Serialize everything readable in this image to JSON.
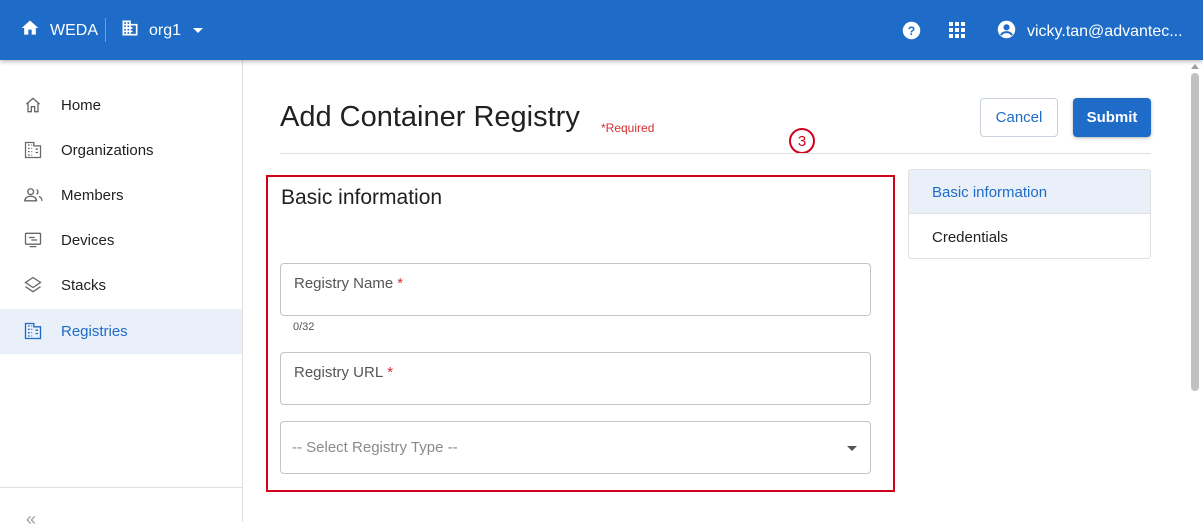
{
  "topbar": {
    "app_name": "WEDA",
    "org_name": "org1",
    "user_email": "vicky.tan@advantec...",
    "icons": {
      "home": "home-icon",
      "org": "building-icon",
      "help": "help-circle-icon",
      "apps": "apps-grid-icon",
      "user": "account-circle-icon"
    },
    "color": "#1e6cc7"
  },
  "sidebar": {
    "items": [
      {
        "label": "Home",
        "icon": "home-outline-icon",
        "active": false
      },
      {
        "label": "Organizations",
        "icon": "building-icon",
        "active": false
      },
      {
        "label": "Members",
        "icon": "members-icon",
        "active": false
      },
      {
        "label": "Devices",
        "icon": "device-icon",
        "active": false
      },
      {
        "label": "Stacks",
        "icon": "layers-icon",
        "active": false
      },
      {
        "label": "Registries",
        "icon": "building-icon",
        "active": true
      }
    ],
    "collapse_glyph": "«"
  },
  "page": {
    "title": "Add Container Registry",
    "required_note": "*Required",
    "step_badge": "3",
    "cancel_label": "Cancel",
    "submit_label": "Submit"
  },
  "form": {
    "section_title": "Basic information",
    "registry_name_label": "Registry Name",
    "registry_name_value": "",
    "registry_name_counter": "0/32",
    "registry_url_label": "Registry URL",
    "registry_url_value": "",
    "required_mark": "*",
    "registry_type_selected": "-- Select Registry Type --"
  },
  "side_nav": {
    "items": [
      {
        "label": "Basic information",
        "active": true
      },
      {
        "label": "Credentials",
        "active": false
      }
    ]
  },
  "colors": {
    "accent": "#1e6cc7",
    "highlight": "#d0021b",
    "required": "#d32f2f"
  }
}
